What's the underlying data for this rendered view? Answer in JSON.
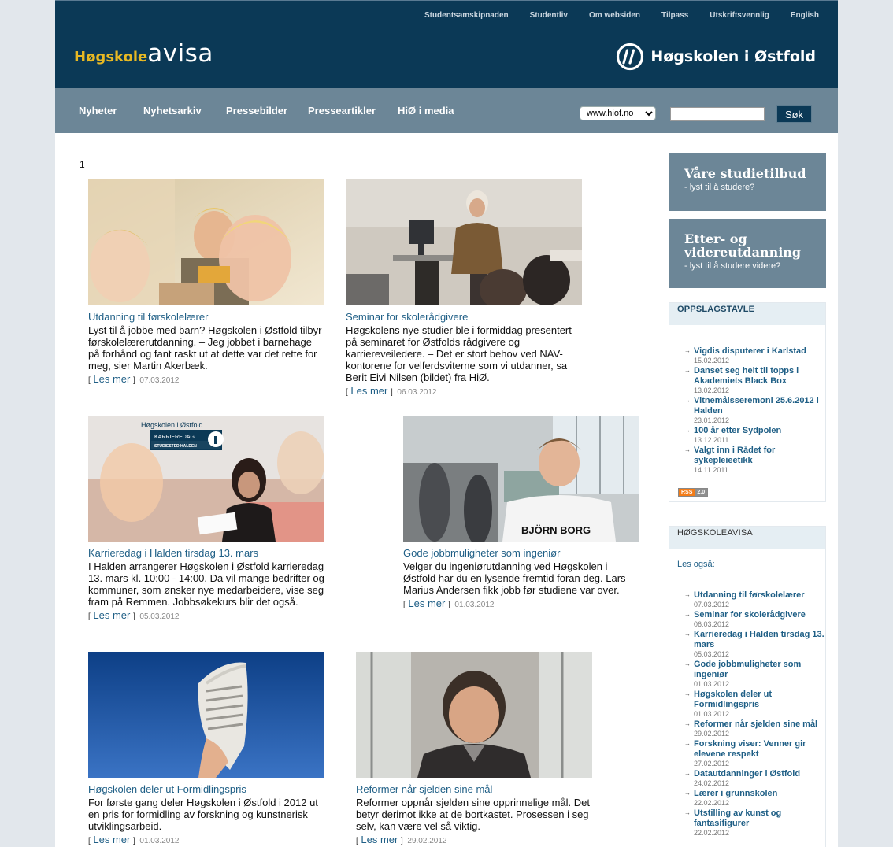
{
  "top_links": [
    "Studentsamskipnaden",
    "Studentliv",
    "Om websiden",
    "Tilpass",
    "Utskriftsvennlig",
    "English"
  ],
  "logo": {
    "prefix": "Høgskole",
    "suffix": "avisa"
  },
  "institution": {
    "name": "Høgskolen i Østfold"
  },
  "nav": {
    "items": [
      "Nyheter",
      "Nyhetsarkiv",
      "Pressebilder",
      "Presseartikler",
      "HiØ i media"
    ],
    "site_select": "www.hiof.no",
    "search_button": "Søk"
  },
  "pager": "1",
  "read_more": "Les mer",
  "articles": [
    {
      "title": "Utdanning til førskolelærer",
      "text": "Lyst til å jobbe med barn? Høgskolen i Østfold tilbyr førskolelærerutdanning. – Jeg jobbet i barnehage på forhånd og fant raskt ut at dette var det rette for meg, sier Martin Akerbæk.",
      "date": "07.03.2012"
    },
    {
      "title": "Seminar for skolerådgivere",
      "text": "Høgskolens nye studier ble i formiddag presentert på seminaret for Østfolds rådgivere og karriereveiledere. – Det er stort behov ved NAV-kontorene for velferdsviterne som vi utdanner, sa Berit Eivi Nilsen (bildet) fra HiØ.",
      "date": "06.03.2012"
    },
    {
      "title": "Karrieredag i Halden tirsdag 13. mars",
      "text": "I Halden arrangerer Høgskolen i Østfold karrieredag 13. mars kl. 10:00 - 14:00. Da vil mange bedrifter og kommuner, som ønsker nye medarbeidere, vise seg fram på Remmen. Jobbsøkekurs blir det også.",
      "date": "05.03.2012"
    },
    {
      "title": "Gode jobbmuligheter som ingeniør",
      "text": "Velger du ingeniørutdanning ved Høgskolen i Østfold har du en lysende fremtid foran deg. Lars-Marius Andersen fikk jobb før studiene var over.",
      "date": "01.03.2012"
    },
    {
      "title": "Høgskolen deler ut Formidlingspris",
      "text": "For første gang deler Høgskolen i Østfold i 2012 ut en pris for formidling av forskning og kunstnerisk utviklingsarbeid.",
      "date": "01.03.2012"
    },
    {
      "title": "Reformer når sjelden sine mål",
      "text": "Reformer oppnår sjelden sine opprinnelige mål. Det betyr derimot ikke at de bortkastet. Prosessen i seg selv, kan være vel så viktig.",
      "date": "29.02.2012"
    }
  ],
  "photo_text": {
    "karrieredag_sign": "Høgskolen i Østfold",
    "karrieredag_label": "KARRIEREDAG",
    "karrieredag_sub": "STUDIESTED HALDEN",
    "shirt": "BJÖRN BORG"
  },
  "promos": [
    {
      "title": "Våre studietilbud",
      "sub": "- lyst til å studere?"
    },
    {
      "title": "Etter- og videreutdanning",
      "sub": "- lyst til å studere videre?"
    }
  ],
  "oppslagstavle": {
    "heading": "OPPSLAGSTAVLE",
    "items": [
      {
        "title": "Vigdis disputerer i Karlstad",
        "date": "15.02.2012"
      },
      {
        "title": "Danset seg helt til topps i Akademiets Black Box",
        "date": "13.02.2012"
      },
      {
        "title": "Vitnemålsseremoni 25.6.2012 i Halden",
        "date": "23.01.2012"
      },
      {
        "title": "100 år etter Sydpolen",
        "date": "13.12.2011"
      },
      {
        "title": "Valgt inn i Rådet for sykepleieetikk",
        "date": "14.11.2011"
      }
    ],
    "rss": "RSS",
    "rss_version": "2.0"
  },
  "hogskoleavisa": {
    "heading": "HØGSKOLEAVISA",
    "intro": "Les også:",
    "items": [
      {
        "title": "Utdanning til førskolelærer",
        "date": "07.03.2012"
      },
      {
        "title": "Seminar for skolerådgivere",
        "date": "06.03.2012"
      },
      {
        "title": "Karrieredag i Halden tirsdag 13. mars",
        "date": "05.03.2012"
      },
      {
        "title": "Gode jobbmuligheter som ingeniør",
        "date": "01.03.2012"
      },
      {
        "title": "Høgskolen deler ut Formidlingspris",
        "date": "01.03.2012"
      },
      {
        "title": "Reformer når sjelden sine mål",
        "date": "29.02.2012"
      },
      {
        "title": "Forskning viser: Venner gir elevene respekt",
        "date": "27.02.2012"
      },
      {
        "title": "Datautdanninger i Østfold",
        "date": "24.02.2012"
      },
      {
        "title": "Lærer i grunnskolen",
        "date": "22.02.2012"
      },
      {
        "title": "Utstilling av kunst og fantasifigurer",
        "date": "22.02.2012"
      }
    ]
  },
  "colors": {
    "header": "#0b3956",
    "nav": "#6c8697",
    "link": "#1f5f86",
    "logo_accent": "#e8b923"
  }
}
